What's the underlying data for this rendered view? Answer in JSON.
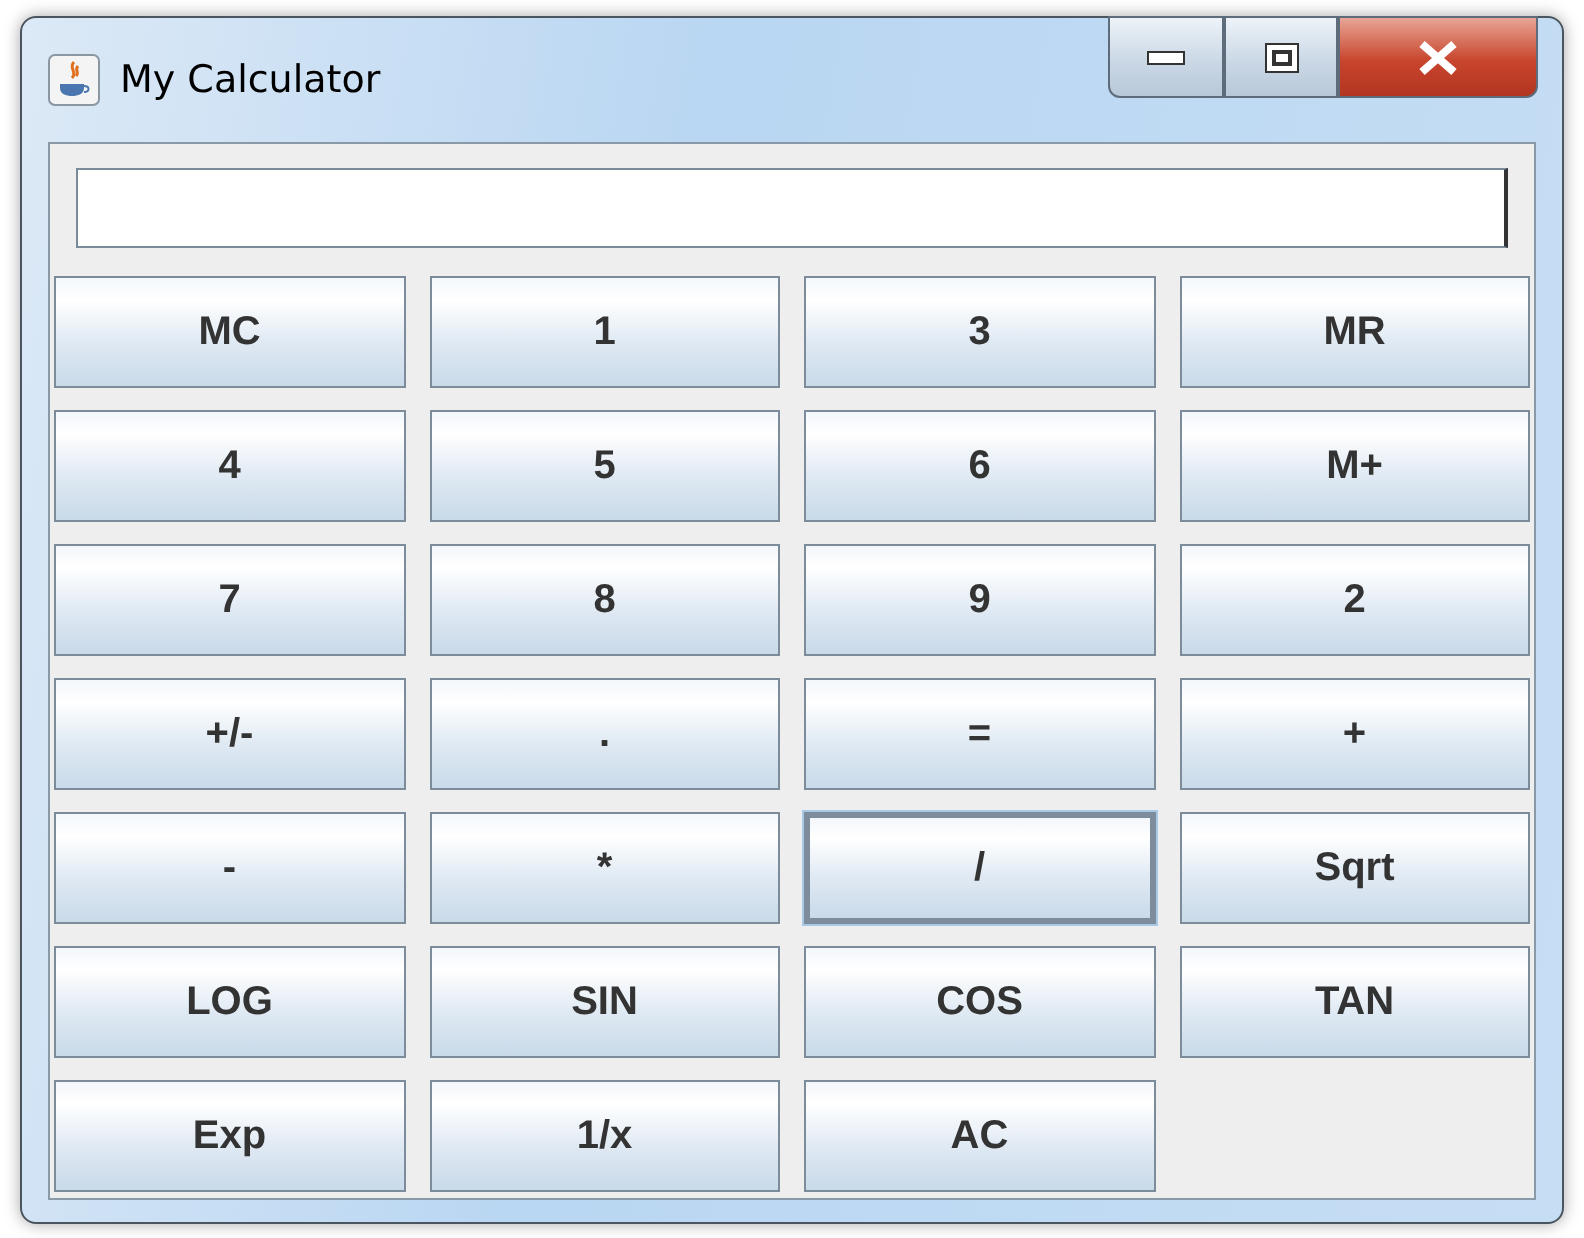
{
  "window": {
    "title": "My Calculator"
  },
  "buttons": [
    {
      "label": "MC",
      "focused": false
    },
    {
      "label": "1",
      "focused": false
    },
    {
      "label": "3",
      "focused": false
    },
    {
      "label": "MR",
      "focused": false
    },
    {
      "label": "4",
      "focused": false
    },
    {
      "label": "5",
      "focused": false
    },
    {
      "label": "6",
      "focused": false
    },
    {
      "label": "M+",
      "focused": false
    },
    {
      "label": "7",
      "focused": false
    },
    {
      "label": "8",
      "focused": false
    },
    {
      "label": "9",
      "focused": false
    },
    {
      "label": "2",
      "focused": false
    },
    {
      "label": "+/-",
      "focused": false
    },
    {
      "label": ".",
      "focused": false
    },
    {
      "label": "=",
      "focused": false
    },
    {
      "label": "+",
      "focused": false
    },
    {
      "label": "-",
      "focused": false
    },
    {
      "label": "*",
      "focused": false
    },
    {
      "label": "/",
      "focused": true
    },
    {
      "label": "Sqrt",
      "focused": false
    },
    {
      "label": "LOG",
      "focused": false
    },
    {
      "label": "SIN",
      "focused": false
    },
    {
      "label": "COS",
      "focused": false
    },
    {
      "label": "TAN",
      "focused": false
    },
    {
      "label": "Exp",
      "focused": false
    },
    {
      "label": "1/x",
      "focused": false
    },
    {
      "label": "AC",
      "focused": false
    }
  ]
}
